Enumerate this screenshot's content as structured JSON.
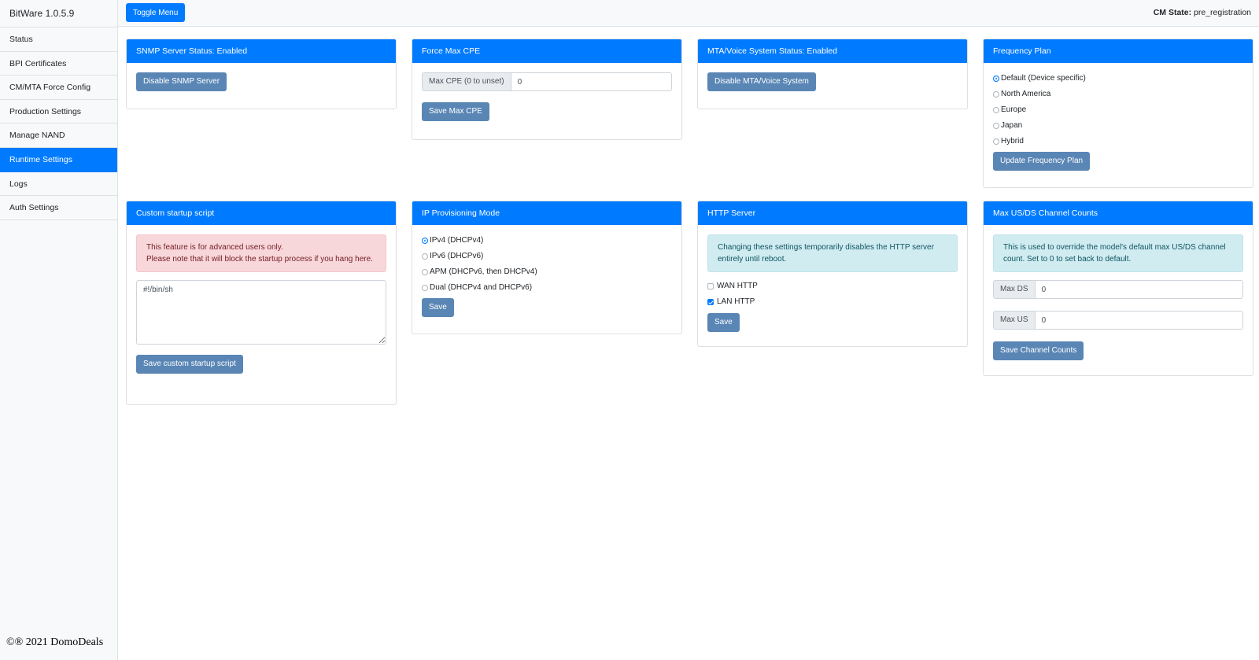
{
  "sidebar": {
    "brand": "BitWare 1.0.5.9",
    "items": [
      {
        "label": "Status"
      },
      {
        "label": "BPI Certificates"
      },
      {
        "label": "CM/MTA Force Config"
      },
      {
        "label": "Production Settings"
      },
      {
        "label": "Manage NAND"
      },
      {
        "label": "Runtime Settings",
        "active": true
      },
      {
        "label": "Logs"
      },
      {
        "label": "Auth Settings"
      }
    ],
    "footer": "©® 2021 DomoDeals"
  },
  "topbar": {
    "toggle_label": "Toggle Menu",
    "cm_state_label": "CM State:",
    "cm_state_value": " pre_registration"
  },
  "snmp": {
    "header": "SNMP Server Status: Enabled",
    "button": "Disable SNMP Server"
  },
  "max_cpe": {
    "header": "Force Max CPE",
    "prefix": "Max CPE (0 to unset)",
    "value": "0",
    "button": "Save Max CPE"
  },
  "mta": {
    "header": "MTA/Voice System Status: Enabled",
    "button": "Disable MTA/Voice System"
  },
  "freq": {
    "header": "Frequency Plan",
    "options": [
      "Default (Device specific)",
      "North America",
      "Europe",
      "Japan",
      "Hybrid"
    ],
    "selected": "Default (Device specific)",
    "button": "Update Frequency Plan"
  },
  "startup": {
    "header": "Custom startup script",
    "alert_line1": "This feature is for advanced users only.",
    "alert_line2": "Please note that it will block the startup process if you hang here.",
    "script": "#!/bin/sh",
    "button": "Save custom startup script"
  },
  "ip_mode": {
    "header": "IP Provisioning Mode",
    "options": [
      "IPv4 (DHCPv4)",
      "IPv6 (DHCPv6)",
      "APM (DHCPv6, then DHCPv4)",
      "Dual (DHCPv4 and DHCPv6)"
    ],
    "selected": "IPv4 (DHCPv4)",
    "button": "Save"
  },
  "http": {
    "header": "HTTP Server",
    "info": "Changing these settings temporarily disables the HTTP server entirely until reboot.",
    "wan_label": "WAN HTTP",
    "wan_checked": false,
    "lan_label": "LAN HTTP",
    "lan_checked": true,
    "button": "Save"
  },
  "channels": {
    "header": "Max US/DS Channel Counts",
    "info": "This is used to override the model's default max US/DS channel count. Set to 0 to set back to default.",
    "ds_prefix": "Max DS",
    "ds_value": "0",
    "us_prefix": "Max US",
    "us_value": "0",
    "button": "Save Channel Counts"
  },
  "colors": {
    "primary": "#007bff",
    "secondary_button": "#5a86b5",
    "danger_bg": "#f8d7da",
    "info_bg": "#d1ecf1"
  }
}
